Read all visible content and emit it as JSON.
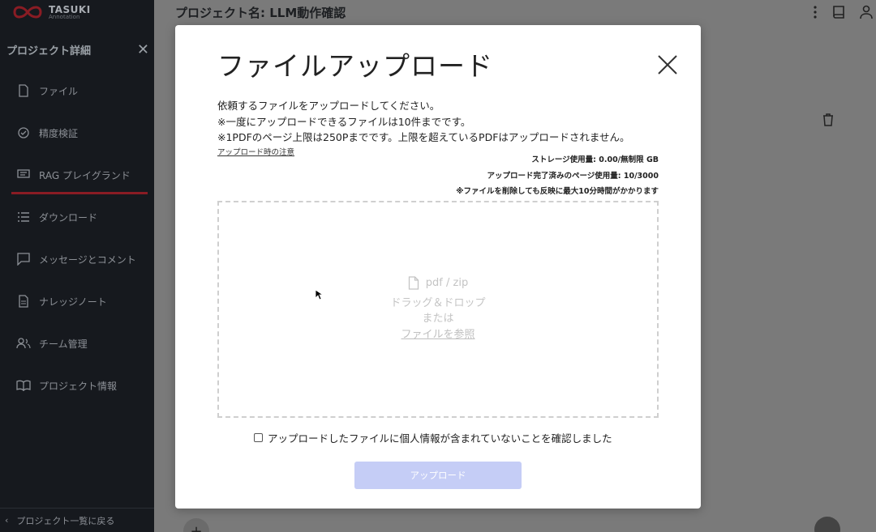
{
  "app": {
    "logo_main": "TASUKI",
    "logo_sub": "Annotation"
  },
  "sidebar": {
    "title": "プロジェクト詳細",
    "items": [
      {
        "label": "ファイル",
        "icon": "file-icon"
      },
      {
        "label": "精度検証",
        "icon": "check-shield-icon"
      },
      {
        "label": "RAG プレイグランド",
        "icon": "chat-icon",
        "active": true
      },
      {
        "label": "ダウンロード",
        "icon": "list-icon"
      },
      {
        "label": "メッセージとコメント",
        "icon": "comment-icon"
      },
      {
        "label": "ナレッジノート",
        "icon": "note-icon"
      },
      {
        "label": "チーム管理",
        "icon": "team-icon"
      },
      {
        "label": "プロジェクト情報",
        "icon": "book-open-icon"
      }
    ],
    "footer": "プロジェクト一覧に戻る"
  },
  "header": {
    "title": "プロジェクト名: LLM動作確認"
  },
  "modal": {
    "title": "ファイルアップロード",
    "notes": [
      "依頼するファイルをアップロードしてください。",
      "※一度にアップロードできるファイルは10件までです。",
      "※1PDFのページ上限は250Pまでです。上限を超えているPDFはアップロードされません。"
    ],
    "notes_link": "アップロード時の注意",
    "usage": [
      "ストレージ使用量: 0.00/無制限 GB",
      "アップロード完了済みのページ使用量: 10/3000",
      "※ファイルを削除しても反映に最大10分時間がかかります"
    ],
    "dropzone": {
      "types": "pdf / zip",
      "drag": "ドラッグ＆ドロップ",
      "or": "または",
      "browse": "ファイルを参照"
    },
    "consent_label": "アップロードしたファイルに個人情報が含まれていないことを確認しました",
    "consent_checked": false,
    "upload_label": "アップロード"
  },
  "colors": {
    "accent": "#8a1c24",
    "button_disabled": "#c5cdf6"
  }
}
